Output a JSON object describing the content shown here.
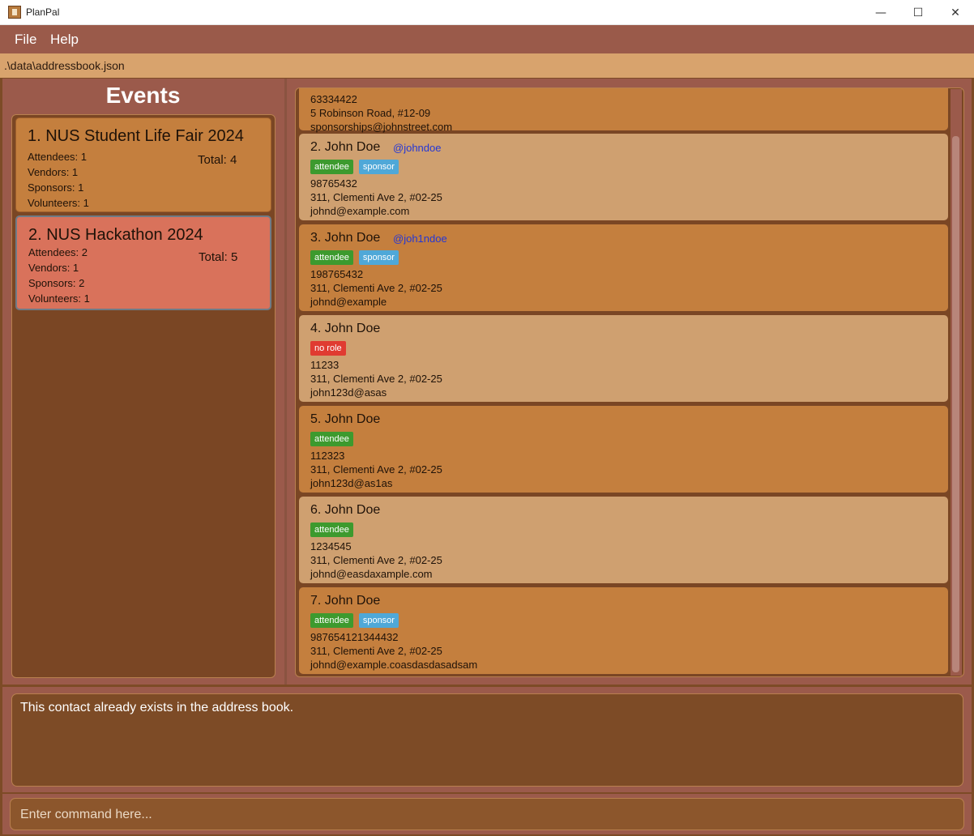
{
  "window": {
    "title": "PlanPal",
    "minimize_glyph": "—",
    "maximize_glyph": "☐",
    "close_glyph": "✕",
    "icon": "planpal-app-icon"
  },
  "menu": {
    "file_label": "File",
    "help_label": "Help"
  },
  "status_path": ".\\data\\addressbook.json",
  "events_panel": {
    "title": "Events",
    "selected_index": 1,
    "events": [
      {
        "name": "1. NUS Student Life Fair 2024",
        "attendees": "Attendees: 1",
        "vendors": "Vendors: 1",
        "sponsors": "Sponsors: 1",
        "volunteers": "Volunteers: 1",
        "total": "Total: 4"
      },
      {
        "name": "2. NUS Hackathon 2024",
        "attendees": "Attendees: 2",
        "vendors": "Vendors: 1",
        "sponsors": "Sponsors: 2",
        "volunteers": "Volunteers: 1",
        "total": "Total: 5"
      }
    ]
  },
  "persons_panel": {
    "partial_card": {
      "phone": "63334422",
      "address": "5 Robinson Road, #12-09",
      "email": "sponsorships@johnstreet.com"
    },
    "persons": [
      {
        "name": "2. John Doe",
        "handle": "@johndoe",
        "tags": [
          "attendee",
          "sponsor"
        ],
        "phone": "98765432",
        "address": "311, Clementi Ave 2, #02-25",
        "email": "johnd@example.com"
      },
      {
        "name": "3. John Doe",
        "handle": "@joh1ndoe",
        "tags": [
          "attendee",
          "sponsor"
        ],
        "phone": "198765432",
        "address": "311, Clementi Ave 2, #02-25",
        "email": "johnd@example"
      },
      {
        "name": "4. John Doe",
        "handle": "",
        "tags": [
          "no role"
        ],
        "phone": "11233",
        "address": "311, Clementi Ave 2, #02-25",
        "email": "john123d@asas"
      },
      {
        "name": "5. John Doe",
        "handle": "",
        "tags": [
          "attendee"
        ],
        "phone": "112323",
        "address": "311, Clementi Ave 2, #02-25",
        "email": "john123d@as1as"
      },
      {
        "name": "6. John Doe",
        "handle": "",
        "tags": [
          "attendee"
        ],
        "phone": "1234545",
        "address": "311, Clementi Ave 2, #02-25",
        "email": "johnd@easdaxample.com"
      },
      {
        "name": "7. John Doe",
        "handle": "",
        "tags": [
          "attendee",
          "sponsor"
        ],
        "phone": "987654121344432",
        "address": "311, Clementi Ave 2, #02-25",
        "email": "johnd@example.coasdasdasadsam"
      }
    ]
  },
  "result_display": {
    "message": "This contact already exists in the address book."
  },
  "command_box": {
    "value": "",
    "placeholder": "Enter command here..."
  },
  "colors": {
    "tag_attendee": "#3d9a2e",
    "tag_sponsor": "#4fa8d8",
    "tag_no_role": "#e03b31",
    "handle": "#2437d6"
  }
}
